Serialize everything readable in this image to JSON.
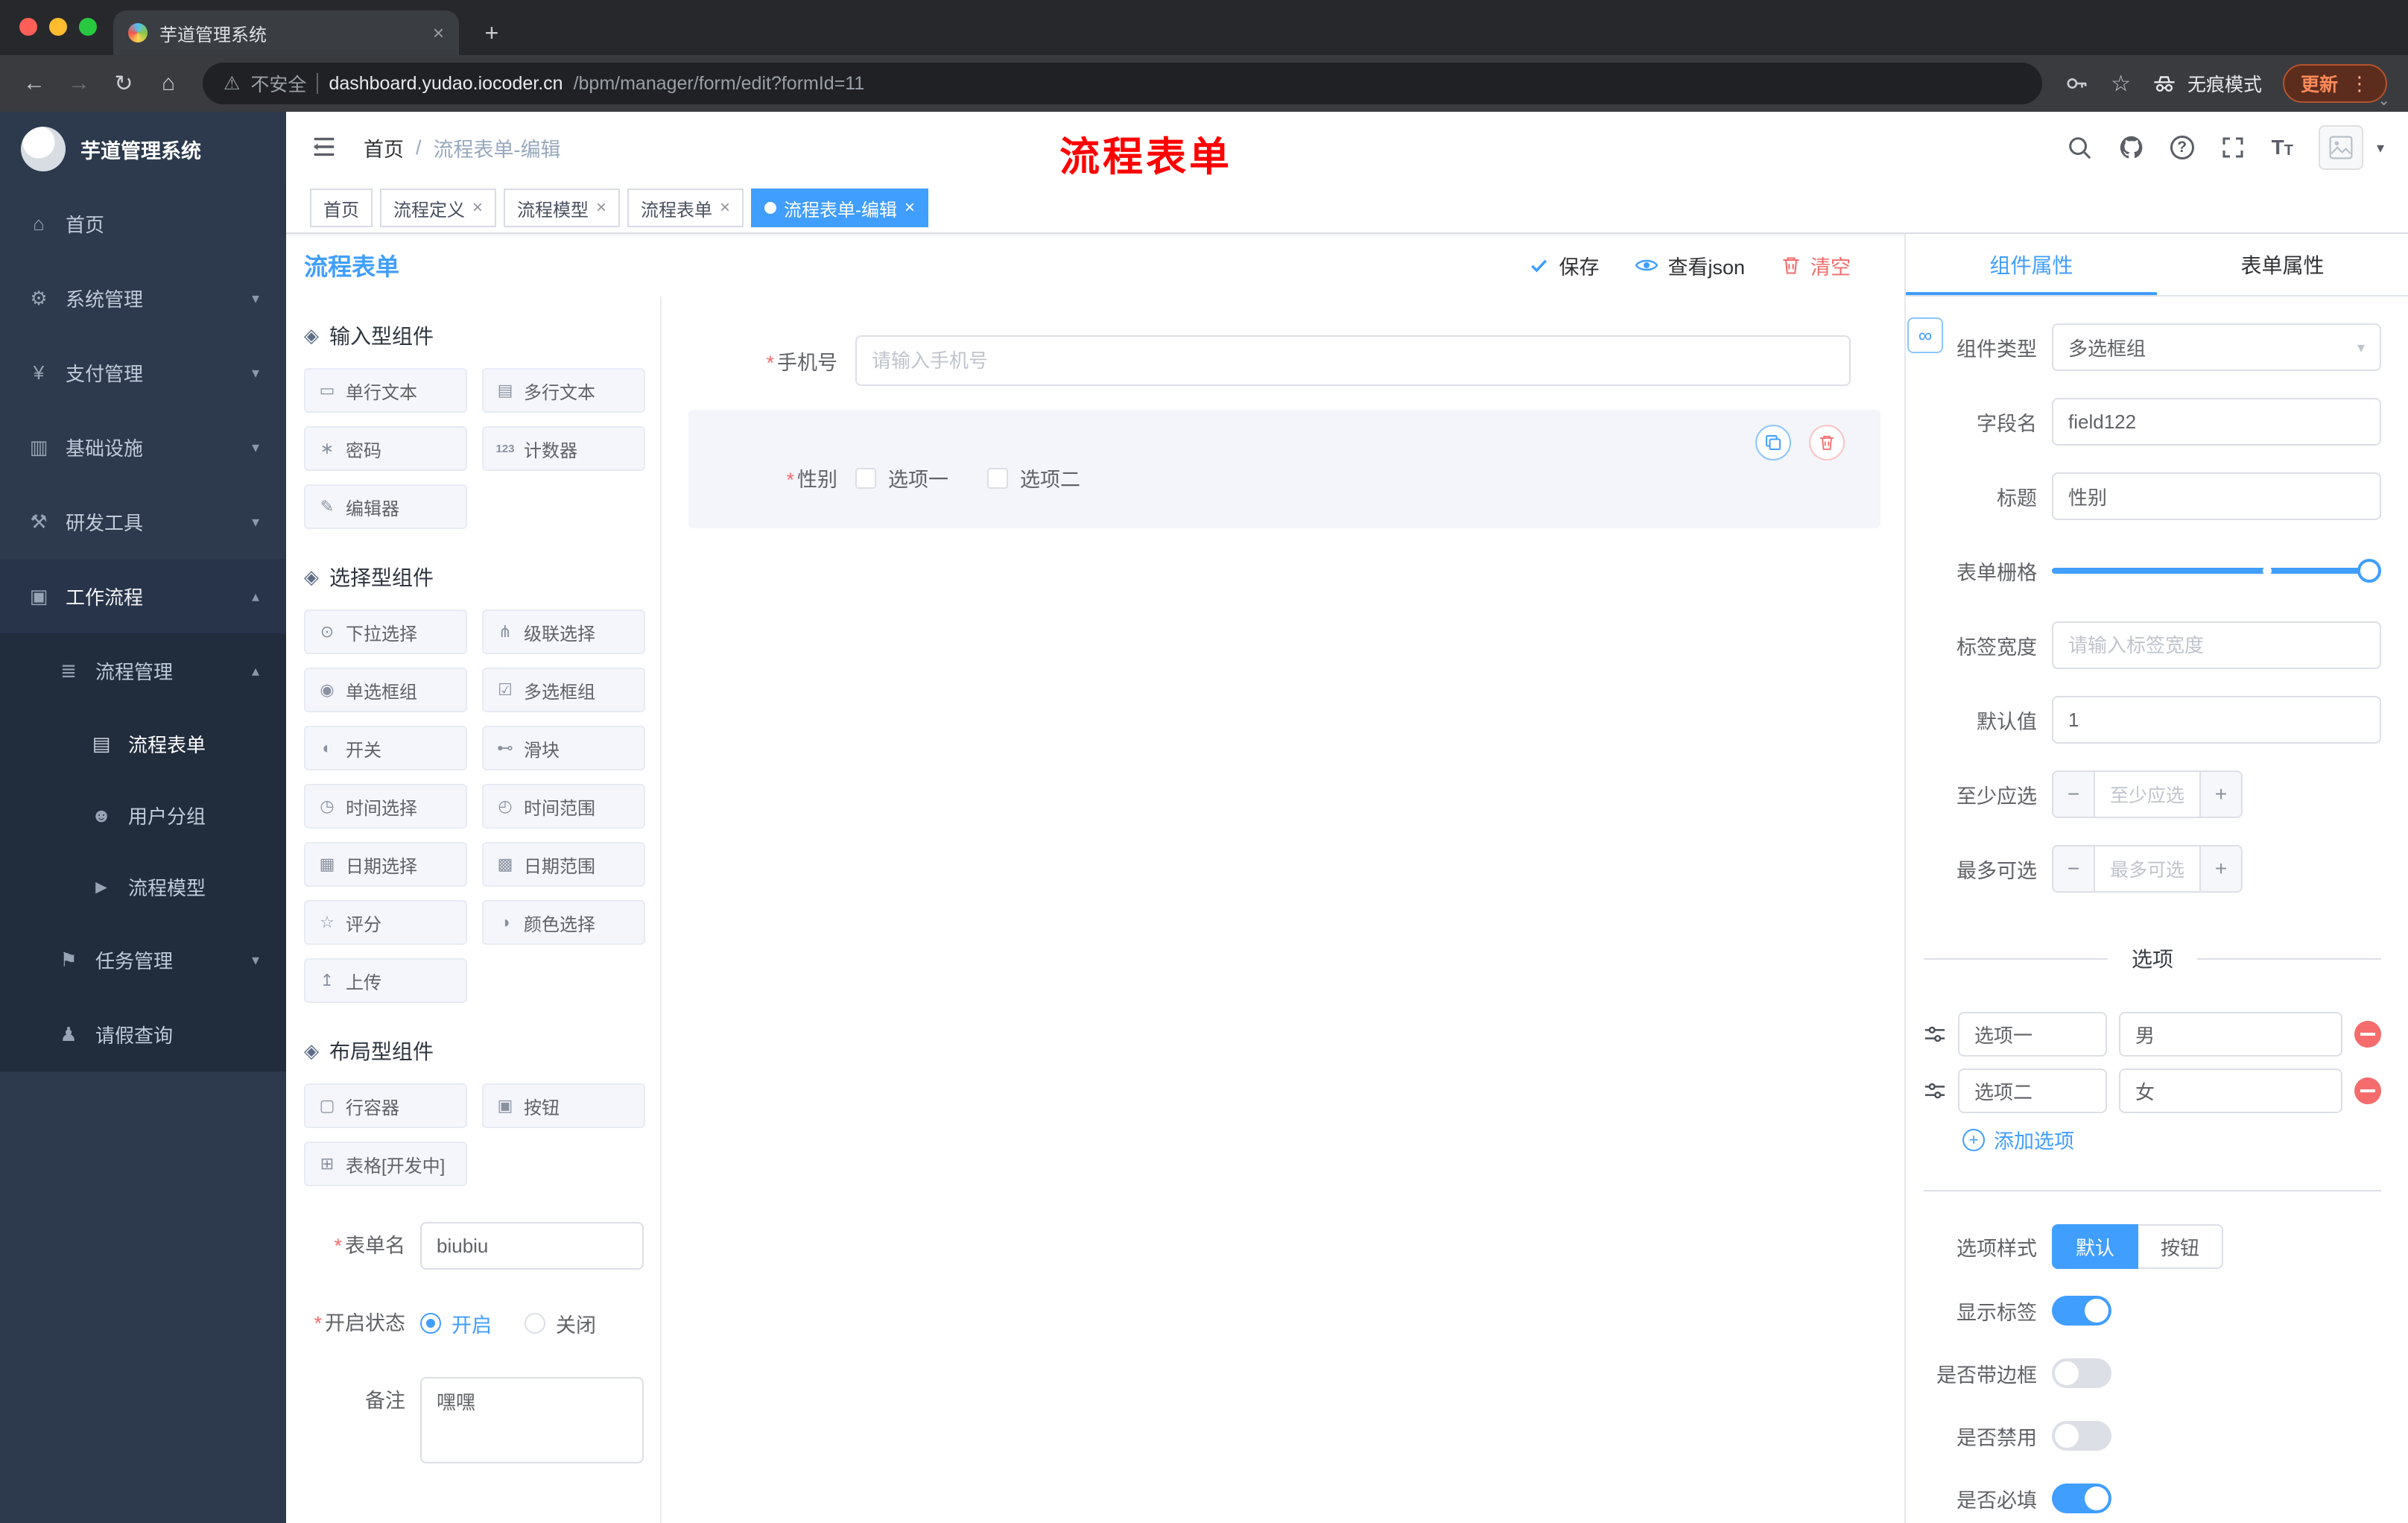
{
  "colors": {
    "accent": "#409eff",
    "danger": "#f56c6c",
    "sidebar": "#2d3a4d",
    "update_orange": "#ff8a5c"
  },
  "required_mark": "*",
  "glyphs": {
    "caret_down": "▾",
    "caret_up": "▴",
    "close": "×",
    "plus": "+",
    "minus": "−",
    "kebab": "⋮",
    "back": "←",
    "forward": "→",
    "reload": "↻",
    "home": "⌂",
    "star": "☆",
    "warning": "⚠",
    "newtab": "+",
    "link": "∞",
    "question": "?",
    "font_icon": "T",
    "tab_search": "⌄",
    "sep": "|"
  },
  "browser": {
    "tab_title": "芋道管理系统",
    "security": "不安全",
    "url_domain": "dashboard.yudao.iocoder.cn",
    "url_path": "/bpm/manager/form/edit?formId=11",
    "incognito": "无痕模式",
    "update": "更新"
  },
  "sidebar": {
    "logo": "芋道管理系统",
    "menu": [
      {
        "label": "首页",
        "icon": "⌂"
      },
      {
        "label": "系统管理",
        "icon": "⚙",
        "arrow": "▾"
      },
      {
        "label": "支付管理",
        "icon": "¥",
        "arrow": "▾"
      },
      {
        "label": "基础设施",
        "icon": "▥",
        "arrow": "▾"
      },
      {
        "label": "研发工具",
        "icon": "⚒",
        "arrow": "▾"
      },
      {
        "label": "工作流程",
        "icon": "▣",
        "arrow": "▴"
      },
      {
        "label": "流程管理",
        "icon": "≣",
        "arrow": "▴"
      },
      {
        "label": "流程表单",
        "icon": "▤"
      },
      {
        "label": "用户分组",
        "icon": "☻"
      },
      {
        "label": "流程模型",
        "icon": "►"
      },
      {
        "label": "任务管理",
        "icon": "⚑",
        "arrow": "▾"
      },
      {
        "label": "请假查询",
        "icon": "♟"
      }
    ]
  },
  "header": {
    "breadcrumb_home": "首页",
    "breadcrumb_sep": "/",
    "breadcrumb_current": "流程表单-编辑",
    "annotation": "流程表单"
  },
  "tags": [
    {
      "label": "首页"
    },
    {
      "label": "流程定义"
    },
    {
      "label": "流程模型"
    },
    {
      "label": "流程表单"
    },
    {
      "label": "流程表单-编辑"
    }
  ],
  "designer": {
    "title": "流程表单",
    "actions": {
      "save": "保存",
      "view_json": "查看json",
      "clear": "清空"
    },
    "palette": {
      "group_icon": "◈",
      "groups": [
        {
          "title": "输入型组件",
          "items": [
            {
              "label": "单行文本",
              "icon": "▭"
            },
            {
              "label": "多行文本",
              "icon": "▤"
            },
            {
              "label": "密码",
              "icon": "∗"
            },
            {
              "label": "计数器",
              "icon": "123"
            },
            {
              "label": "编辑器",
              "icon": "✎"
            }
          ]
        },
        {
          "title": "选择型组件",
          "items": [
            {
              "label": "下拉选择",
              "icon": "⊙"
            },
            {
              "label": "级联选择",
              "icon": "⋔"
            },
            {
              "label": "单选框组",
              "icon": "◉"
            },
            {
              "label": "多选框组",
              "icon": "☑"
            },
            {
              "label": "开关",
              "icon": "◐"
            },
            {
              "label": "滑块",
              "icon": "⊷"
            },
            {
              "label": "时间选择",
              "icon": "◷"
            },
            {
              "label": "时间范围",
              "icon": "◴"
            },
            {
              "label": "日期选择",
              "icon": "▦"
            },
            {
              "label": "日期范围",
              "icon": "▩"
            },
            {
              "label": "评分",
              "icon": "☆"
            },
            {
              "label": "颜色选择",
              "icon": "◑"
            },
            {
              "label": "上传",
              "icon": "↥"
            }
          ]
        },
        {
          "title": "布局型组件",
          "items": [
            {
              "label": "行容器",
              "icon": "▢"
            },
            {
              "label": "按钮",
              "icon": "▣"
            },
            {
              "label": "表格[开发中]",
              "icon": "⊞"
            }
          ]
        }
      ]
    },
    "form": {
      "name_label": "表单名",
      "name_value": "biubiu",
      "status_label": "开启状态",
      "status_on": "开启",
      "status_off": "关闭",
      "remark_label": "备注",
      "remark_value": "嘿嘿"
    },
    "canvas": {
      "phone_label": "手机号",
      "phone_placeholder": "请输入手机号",
      "gender_label": "性别",
      "gender_opt1": "选项一",
      "gender_opt2": "选项二"
    }
  },
  "props": {
    "tab_component": "组件属性",
    "tab_form": "表单属性",
    "type_label": "组件类型",
    "type_value": "多选框组",
    "field_label": "字段名",
    "field_value": "field122",
    "title_label": "标题",
    "title_value": "性别",
    "grid_label": "表单栅格",
    "tagw_label": "标签宽度",
    "tagw_placeholder": "请输入标签宽度",
    "default_label": "默认值",
    "default_value": "1",
    "min_label": "至少应选",
    "min_placeholder": "至少应选",
    "max_label": "最多可选",
    "max_placeholder": "最多可选",
    "options_title": "选项",
    "options": [
      {
        "label": "选项一",
        "value": "男"
      },
      {
        "label": "选项二",
        "value": "女"
      }
    ],
    "add_option": "添加选项",
    "style_label": "选项样式",
    "style_default": "默认",
    "style_button": "按钮",
    "show_label": "显示标签",
    "border_label": "是否带边框",
    "disabled_label": "是否禁用",
    "required_label": "是否必填"
  }
}
